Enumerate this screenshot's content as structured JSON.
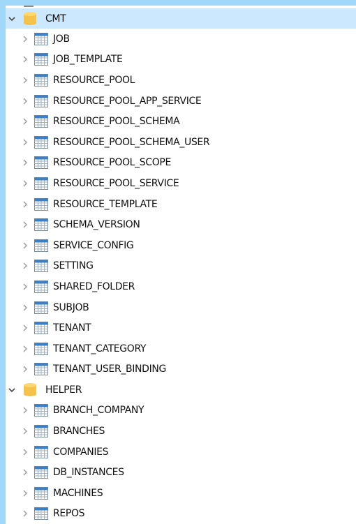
{
  "colors": {
    "background": "#9fd8f8",
    "panel": "#ffffff",
    "selected_row": "#cce8ff",
    "database_icon": "#f5c24a",
    "table_icon_header": "#3b7fc4"
  },
  "tree": {
    "databases": [
      {
        "name": "CMT",
        "expanded": true,
        "selected": true,
        "tables": [
          "JOB",
          "JOB_TEMPLATE",
          "RESOURCE_POOL",
          "RESOURCE_POOL_APP_SERVICE",
          "RESOURCE_POOL_SCHEMA",
          "RESOURCE_POOL_SCHEMA_USER",
          "RESOURCE_POOL_SCOPE",
          "RESOURCE_POOL_SERVICE",
          "RESOURCE_TEMPLATE",
          "SCHEMA_VERSION",
          "SERVICE_CONFIG",
          "SETTING",
          "SHARED_FOLDER",
          "SUBJOB",
          "TENANT",
          "TENANT_CATEGORY",
          "TENANT_USER_BINDING"
        ]
      },
      {
        "name": "HELPER",
        "expanded": true,
        "selected": false,
        "tables": [
          "BRANCH_COMPANY",
          "BRANCHES",
          "COMPANIES",
          "DB_INSTANCES",
          "MACHINES",
          "REPOS"
        ]
      }
    ],
    "icons": {
      "expanded": "chevron-down-icon",
      "collapsed": "chevron-right-icon",
      "database": "database-icon",
      "table": "table-icon"
    }
  }
}
